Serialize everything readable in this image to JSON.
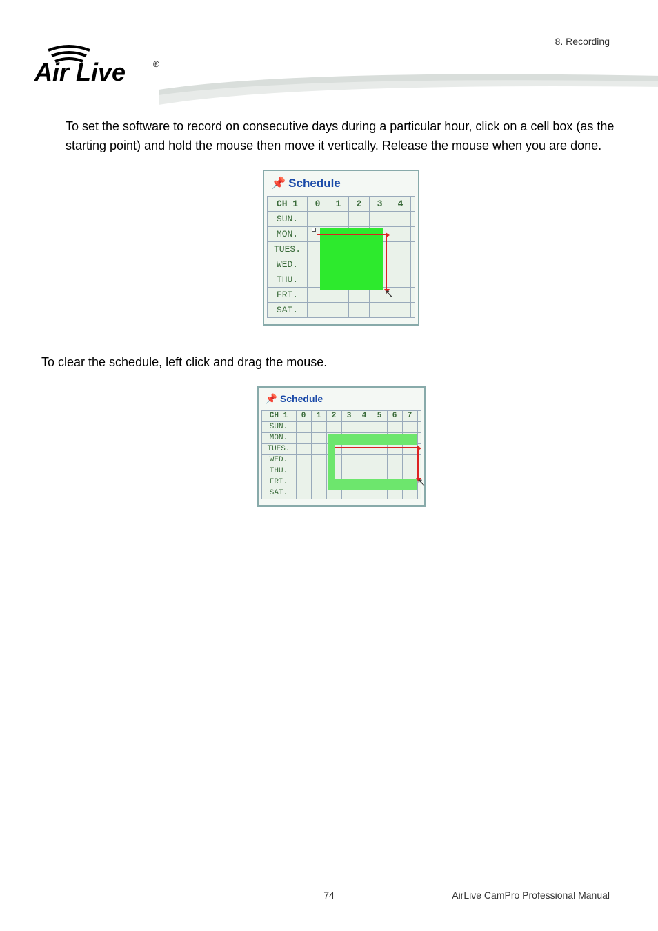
{
  "header": {
    "chapter": "8.  Recording",
    "logo_text": "Air Live",
    "logo_reg": "®"
  },
  "paragraphs": {
    "p1": "To set the software to record on consecutive days during a particular hour, click on a cell box (as the starting point) and hold the mouse then move it vertically. Release the mouse when you are done.",
    "p2": "To clear the schedule, left click and drag the mouse."
  },
  "schedule_large": {
    "title": "Schedule",
    "channel": "CH 1",
    "hours": [
      "0",
      "1",
      "2",
      "3",
      "4"
    ],
    "days": [
      "SUN.",
      "MON.",
      "TUES.",
      "WED.",
      "THU.",
      "FRI.",
      "SAT."
    ]
  },
  "schedule_small": {
    "title": "Schedule",
    "channel": "CH 1",
    "hours": [
      "0",
      "1",
      "2",
      "3",
      "4",
      "5",
      "6",
      "7"
    ],
    "days": [
      "SUN.",
      "MON.",
      "TUES.",
      "WED.",
      "THU.",
      "FRI.",
      "SAT."
    ]
  },
  "footer": {
    "page": "74",
    "title": "AirLive  CamPro  Professional  Manual"
  }
}
